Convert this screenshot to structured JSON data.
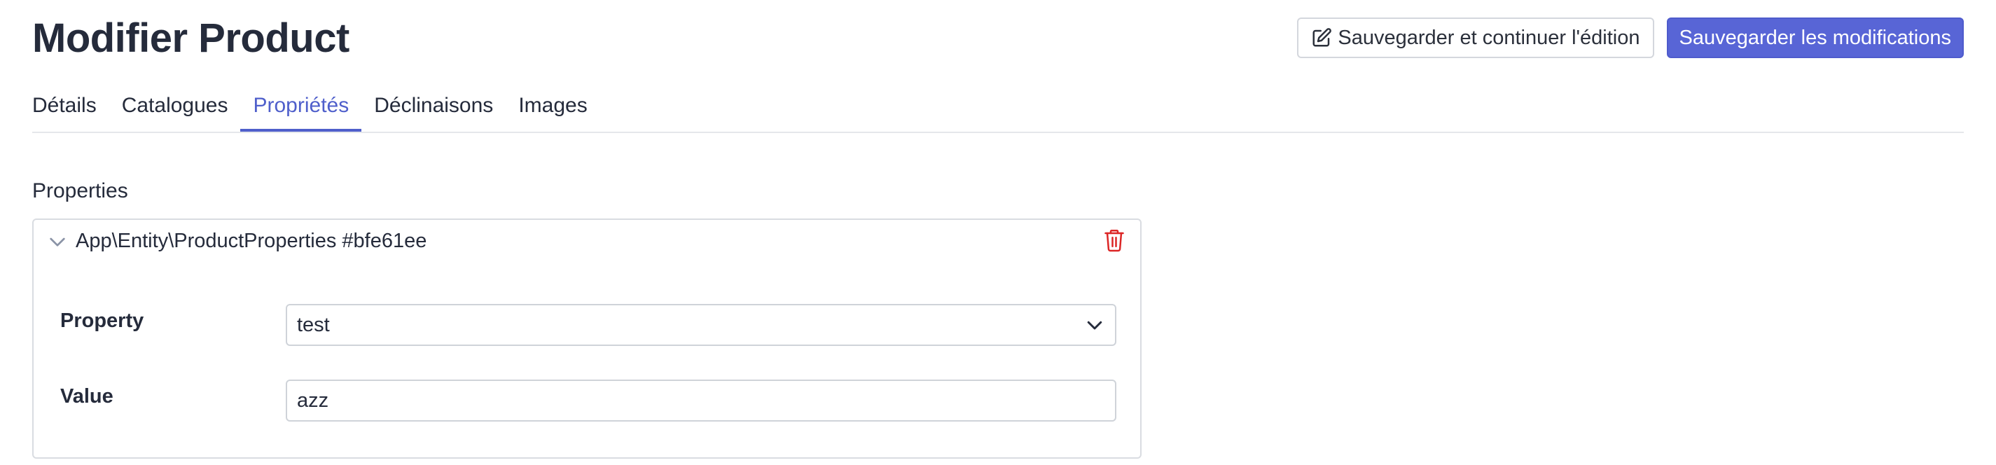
{
  "page": {
    "title": "Modifier Product"
  },
  "actions": {
    "save_continue_label": "Sauvegarder et continuer l'édition",
    "save_label": "Sauvegarder les modifications"
  },
  "tabs": [
    {
      "label": "Détails",
      "active": false
    },
    {
      "label": "Catalogues",
      "active": false
    },
    {
      "label": "Propriétés",
      "active": true
    },
    {
      "label": "Déclinaisons",
      "active": false
    },
    {
      "label": "Images",
      "active": false
    }
  ],
  "properties": {
    "section_label": "Properties",
    "item": {
      "title": "App\\Entity\\ProductProperties #bfe61ee",
      "property_label": "Property",
      "property_value": "test",
      "value_label": "Value",
      "value_value": "azz"
    }
  },
  "icons": {
    "edit": "edit-icon",
    "chevron": "chevron-down-icon",
    "trash": "trash-icon",
    "select_caret": "chevron-down-icon"
  },
  "colors": {
    "primary": "#5865d6",
    "active_tab": "#4f5fcb",
    "danger": "#dc2626"
  }
}
